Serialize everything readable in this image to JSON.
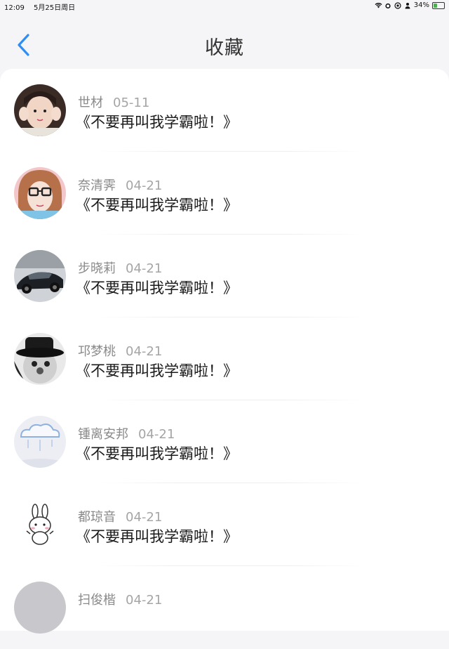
{
  "status_bar": {
    "time": "12:09",
    "date": "5月25日周日",
    "battery": "34%",
    "battery_level": 0.34
  },
  "header": {
    "title": "收藏"
  },
  "favorites": [
    {
      "user": "世材",
      "date": "05-11",
      "title": "《不要再叫我学霸啦！》",
      "avatar": "girl-peace-sign-avatar"
    },
    {
      "user": "奈清霁",
      "date": "04-21",
      "title": "《不要再叫我学霸啦！》",
      "avatar": "girl-glasses-avatar"
    },
    {
      "user": "步晓莉",
      "date": "04-21",
      "title": "《不要再叫我学霸啦！》",
      "avatar": "sports-car-avatar"
    },
    {
      "user": "邛梦桃",
      "date": "04-21",
      "title": "《不要再叫我学霸啦！》",
      "avatar": "clown-hat-avatar"
    },
    {
      "user": "锺离安邦",
      "date": "04-21",
      "title": "《不要再叫我学霸啦！》",
      "avatar": "cloud-sketch-avatar"
    },
    {
      "user": "都琼音",
      "date": "04-21",
      "title": "《不要再叫我学霸啦！》",
      "avatar": "bunny-cartoon-avatar"
    },
    {
      "user": "扫俊楷",
      "date": "04-21",
      "title": "",
      "avatar": "gray-avatar"
    }
  ]
}
